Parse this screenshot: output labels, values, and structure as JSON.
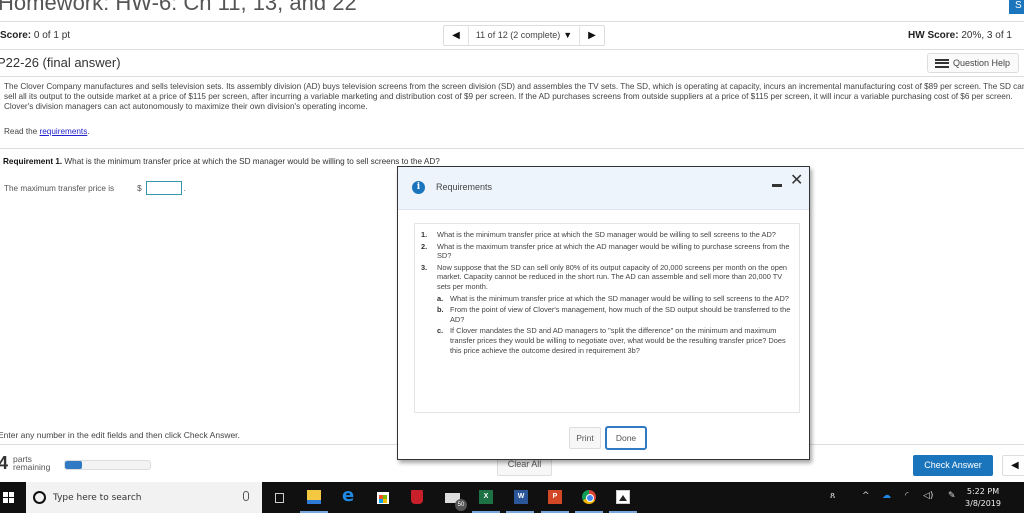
{
  "header": {
    "title": "Homework: HW-6: Ch 11, 13, and 22",
    "top_right_button": "S"
  },
  "score": {
    "label": "Score:",
    "value": "0 of 1 pt"
  },
  "navigator": {
    "prev_icon": "◀",
    "position": "11 of 12 (2 complete)",
    "dropdown_icon": "▼",
    "next_icon": "▶"
  },
  "hw_score": {
    "label": "HW Score:",
    "value": "20%, 3 of 1"
  },
  "question": {
    "title": "P22-26 (final answer)",
    "help_label": "Question Help",
    "problem_text": "The Clover Company manufactures and sells television sets. Its assembly division (AD) buys television screens from the screen division (SD) and assembles the TV sets. The SD, which is operating at capacity, incurs an incremental manufacturing cost of $89 per screen. The SD can sell all its output to the outside market at a price of $115 per screen, after incurring a variable marketing and distribution cost of $9 per screen. If the AD purchases screens from outside suppliers at a price of $115 per screen, it will incur a variable purchasing cost of $6 per screen. Clover's division managers can act autonomously to maximize their own division's operating income.",
    "read_prefix": "Read the ",
    "read_link": "requirements",
    "read_suffix": ".",
    "requirement_label": "Requirement 1.",
    "requirement_text": " What is the minimum transfer price at which the SD manager would be willing to sell screens to the AD?",
    "answer_label": "The maximum transfer price is",
    "answer_currency": "$",
    "answer_value": "",
    "answer_suffix": "."
  },
  "footer": {
    "instruction": "Enter any number in the edit fields and then click Check Answer.",
    "parts_count": "4",
    "parts_label_1": "parts",
    "parts_label_2": "remaining",
    "progress_fraction": 0.2,
    "clear_all": "Clear All",
    "check_answer": "Check Answer",
    "back_icon": "◀"
  },
  "modal": {
    "title": "Requirements",
    "info_icon": "i",
    "close_icon": "✕",
    "items": [
      {
        "n": "1.",
        "text": "What is the minimum transfer price at which the SD manager would be willing to sell screens to the AD?"
      },
      {
        "n": "2.",
        "text": "What is the maximum transfer price at which the AD manager would be willing to purchase screens from the SD?"
      },
      {
        "n": "3.",
        "text": "Now suppose that the SD can sell only 80% of its output capacity of 20,000 screens per month on the open market. Capacity cannot be reduced in the short run. The AD can assemble and sell more than 20,000 TV sets per month."
      }
    ],
    "sub_items": [
      {
        "n": "a.",
        "text": "What is the minimum transfer price at which the SD manager would be willing to sell screens to the AD?"
      },
      {
        "n": "b.",
        "text": "From the point of view of Clover's management, how much of the SD output should be transferred to the AD?"
      },
      {
        "n": "c.",
        "text": "If Clover mandates the SD and AD managers to \"split the difference\" on the minimum and maximum transfer prices they would be willing to negotiate over, what would be the resulting transfer price? Does this price achieve the outcome desired in requirement 3b?"
      }
    ],
    "print": "Print",
    "done": "Done"
  },
  "taskbar": {
    "search_placeholder": "Type here to search",
    "mail_badge": "50",
    "excel_label": "X",
    "word_label": "W",
    "ppt_label": "P",
    "edge_label": "e",
    "time": "5:22 PM",
    "date": "3/8/2019"
  }
}
